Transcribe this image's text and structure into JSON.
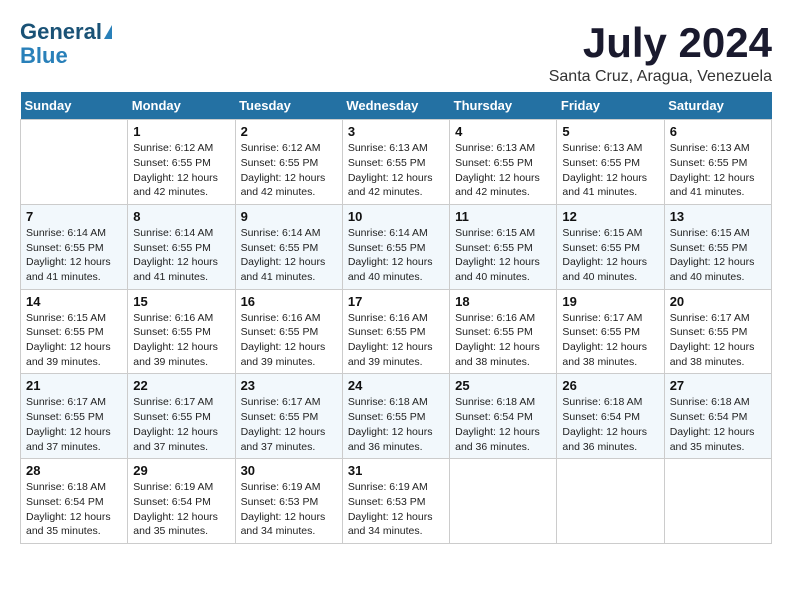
{
  "header": {
    "logo_line1": "General",
    "logo_line2": "Blue",
    "month_title": "July 2024",
    "location": "Santa Cruz, Aragua, Venezuela"
  },
  "days_of_week": [
    "Sunday",
    "Monday",
    "Tuesday",
    "Wednesday",
    "Thursday",
    "Friday",
    "Saturday"
  ],
  "weeks": [
    [
      {
        "day": "",
        "info": ""
      },
      {
        "day": "1",
        "info": "Sunrise: 6:12 AM\nSunset: 6:55 PM\nDaylight: 12 hours\nand 42 minutes."
      },
      {
        "day": "2",
        "info": "Sunrise: 6:12 AM\nSunset: 6:55 PM\nDaylight: 12 hours\nand 42 minutes."
      },
      {
        "day": "3",
        "info": "Sunrise: 6:13 AM\nSunset: 6:55 PM\nDaylight: 12 hours\nand 42 minutes."
      },
      {
        "day": "4",
        "info": "Sunrise: 6:13 AM\nSunset: 6:55 PM\nDaylight: 12 hours\nand 42 minutes."
      },
      {
        "day": "5",
        "info": "Sunrise: 6:13 AM\nSunset: 6:55 PM\nDaylight: 12 hours\nand 41 minutes."
      },
      {
        "day": "6",
        "info": "Sunrise: 6:13 AM\nSunset: 6:55 PM\nDaylight: 12 hours\nand 41 minutes."
      }
    ],
    [
      {
        "day": "7",
        "info": "Sunrise: 6:14 AM\nSunset: 6:55 PM\nDaylight: 12 hours\nand 41 minutes."
      },
      {
        "day": "8",
        "info": "Sunrise: 6:14 AM\nSunset: 6:55 PM\nDaylight: 12 hours\nand 41 minutes."
      },
      {
        "day": "9",
        "info": "Sunrise: 6:14 AM\nSunset: 6:55 PM\nDaylight: 12 hours\nand 41 minutes."
      },
      {
        "day": "10",
        "info": "Sunrise: 6:14 AM\nSunset: 6:55 PM\nDaylight: 12 hours\nand 40 minutes."
      },
      {
        "day": "11",
        "info": "Sunrise: 6:15 AM\nSunset: 6:55 PM\nDaylight: 12 hours\nand 40 minutes."
      },
      {
        "day": "12",
        "info": "Sunrise: 6:15 AM\nSunset: 6:55 PM\nDaylight: 12 hours\nand 40 minutes."
      },
      {
        "day": "13",
        "info": "Sunrise: 6:15 AM\nSunset: 6:55 PM\nDaylight: 12 hours\nand 40 minutes."
      }
    ],
    [
      {
        "day": "14",
        "info": "Sunrise: 6:15 AM\nSunset: 6:55 PM\nDaylight: 12 hours\nand 39 minutes."
      },
      {
        "day": "15",
        "info": "Sunrise: 6:16 AM\nSunset: 6:55 PM\nDaylight: 12 hours\nand 39 minutes."
      },
      {
        "day": "16",
        "info": "Sunrise: 6:16 AM\nSunset: 6:55 PM\nDaylight: 12 hours\nand 39 minutes."
      },
      {
        "day": "17",
        "info": "Sunrise: 6:16 AM\nSunset: 6:55 PM\nDaylight: 12 hours\nand 39 minutes."
      },
      {
        "day": "18",
        "info": "Sunrise: 6:16 AM\nSunset: 6:55 PM\nDaylight: 12 hours\nand 38 minutes."
      },
      {
        "day": "19",
        "info": "Sunrise: 6:17 AM\nSunset: 6:55 PM\nDaylight: 12 hours\nand 38 minutes."
      },
      {
        "day": "20",
        "info": "Sunrise: 6:17 AM\nSunset: 6:55 PM\nDaylight: 12 hours\nand 38 minutes."
      }
    ],
    [
      {
        "day": "21",
        "info": "Sunrise: 6:17 AM\nSunset: 6:55 PM\nDaylight: 12 hours\nand 37 minutes."
      },
      {
        "day": "22",
        "info": "Sunrise: 6:17 AM\nSunset: 6:55 PM\nDaylight: 12 hours\nand 37 minutes."
      },
      {
        "day": "23",
        "info": "Sunrise: 6:17 AM\nSunset: 6:55 PM\nDaylight: 12 hours\nand 37 minutes."
      },
      {
        "day": "24",
        "info": "Sunrise: 6:18 AM\nSunset: 6:55 PM\nDaylight: 12 hours\nand 36 minutes."
      },
      {
        "day": "25",
        "info": "Sunrise: 6:18 AM\nSunset: 6:54 PM\nDaylight: 12 hours\nand 36 minutes."
      },
      {
        "day": "26",
        "info": "Sunrise: 6:18 AM\nSunset: 6:54 PM\nDaylight: 12 hours\nand 36 minutes."
      },
      {
        "day": "27",
        "info": "Sunrise: 6:18 AM\nSunset: 6:54 PM\nDaylight: 12 hours\nand 35 minutes."
      }
    ],
    [
      {
        "day": "28",
        "info": "Sunrise: 6:18 AM\nSunset: 6:54 PM\nDaylight: 12 hours\nand 35 minutes."
      },
      {
        "day": "29",
        "info": "Sunrise: 6:19 AM\nSunset: 6:54 PM\nDaylight: 12 hours\nand 35 minutes."
      },
      {
        "day": "30",
        "info": "Sunrise: 6:19 AM\nSunset: 6:53 PM\nDaylight: 12 hours\nand 34 minutes."
      },
      {
        "day": "31",
        "info": "Sunrise: 6:19 AM\nSunset: 6:53 PM\nDaylight: 12 hours\nand 34 minutes."
      },
      {
        "day": "",
        "info": ""
      },
      {
        "day": "",
        "info": ""
      },
      {
        "day": "",
        "info": ""
      }
    ]
  ]
}
